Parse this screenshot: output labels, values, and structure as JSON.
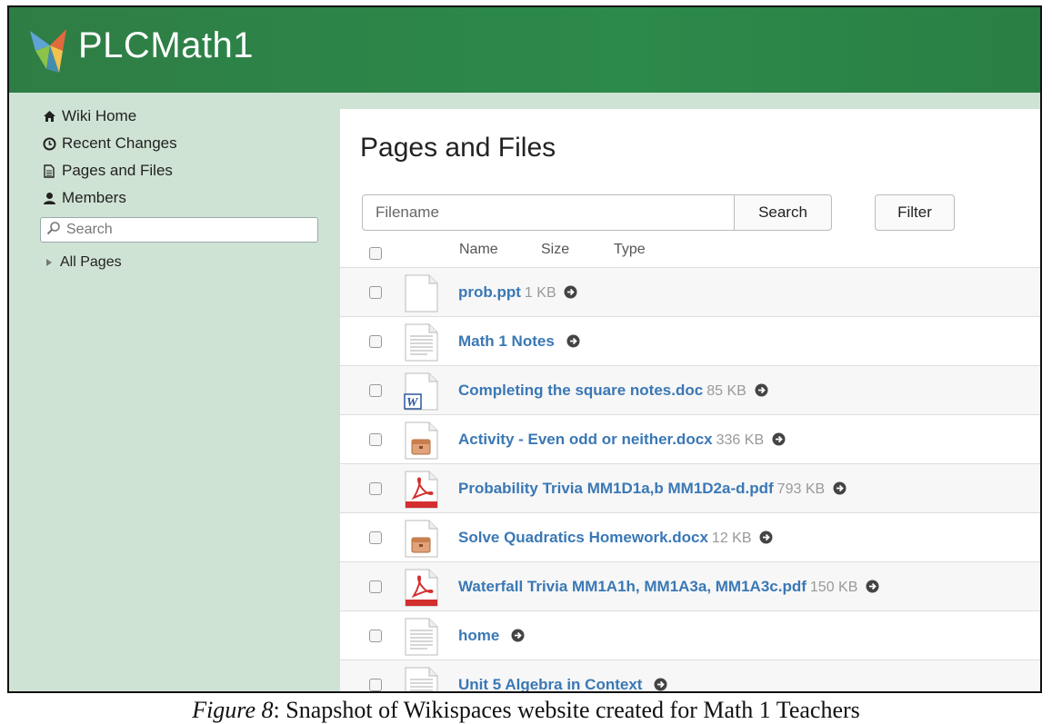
{
  "app": {
    "title": "PLCMath1"
  },
  "sidebar": {
    "items": [
      {
        "label": "Wiki Home",
        "icon": "home-icon"
      },
      {
        "label": "Recent Changes",
        "icon": "clock-icon"
      },
      {
        "label": "Pages and Files",
        "icon": "file-icon"
      },
      {
        "label": "Members",
        "icon": "user-icon"
      }
    ],
    "search_placeholder": "Search",
    "all_pages_label": "All Pages"
  },
  "main": {
    "title": "Pages and Files",
    "filename_placeholder": "Filename",
    "search_label": "Search",
    "filter_label": "Filter",
    "columns": [
      "Name",
      "Size",
      "Type"
    ],
    "files": [
      {
        "name": "prob.ppt",
        "size": "1 KB",
        "icon": "blank-file-icon"
      },
      {
        "name": "Math 1 Notes",
        "size": "",
        "icon": "page-icon"
      },
      {
        "name": "Completing the square notes.doc",
        "size": "85 KB",
        "icon": "word-doc-icon"
      },
      {
        "name": "Activity - Even odd or neither.docx",
        "size": "336 KB",
        "icon": "archive-file-icon"
      },
      {
        "name": "Probability Trivia MM1D1a,b MM1D2a-d.pdf",
        "size": "793 KB",
        "icon": "pdf-icon"
      },
      {
        "name": "Solve Quadratics Homework.docx",
        "size": "12 KB",
        "icon": "archive-file-icon"
      },
      {
        "name": "Waterfall Trivia MM1A1h, MM1A3a, MM1A3c.pdf",
        "size": "150 KB",
        "icon": "pdf-icon"
      },
      {
        "name": "home",
        "size": "",
        "icon": "page-icon"
      },
      {
        "name": "Unit 5 Algebra in Context",
        "size": "",
        "icon": "page-icon"
      }
    ]
  },
  "caption": {
    "label": "Figure 8",
    "text": ": Snapshot of Wikispaces website created for Math 1 Teachers"
  },
  "colors": {
    "header": "#2c8a4b",
    "sidebar": "#cfe3d4",
    "link": "#3a78b5"
  }
}
